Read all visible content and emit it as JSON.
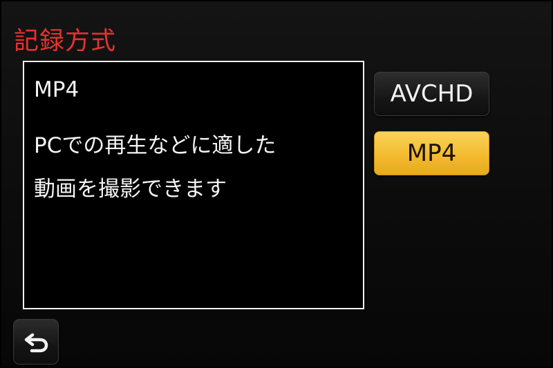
{
  "header": {
    "title": "記録方式"
  },
  "info_panel": {
    "heading": "MP4",
    "description_lines": [
      "PCでの再生などに適した",
      "動画を撮影できます"
    ]
  },
  "options": [
    {
      "label": "AVCHD",
      "selected": false
    },
    {
      "label": "MP4",
      "selected": true
    }
  ],
  "colors": {
    "title": "#e8312f",
    "selected_button": "#f3bb2f",
    "panel_border": "#f2f2f2"
  },
  "icons": {
    "back": "return-arrow-icon"
  }
}
